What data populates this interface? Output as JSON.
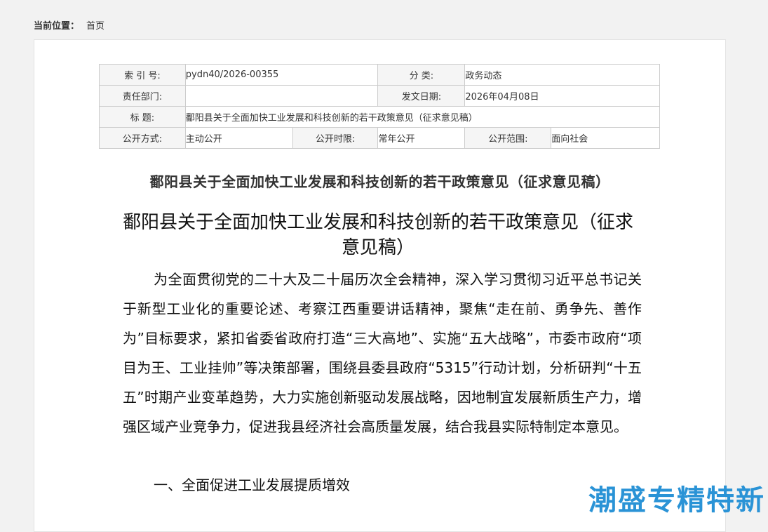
{
  "breadcrumb": {
    "label": "当前位置：",
    "current": "首页"
  },
  "meta": {
    "index_key": "索 引 号:",
    "index_value": "pydn40/2026-00355",
    "category_key": "分 类:",
    "category_value": "政务动态",
    "dept_key": "责任部门:",
    "dept_value": "",
    "date_key": "发文日期:",
    "date_value": "2026年04月08日",
    "title_key": "标 题:",
    "title_value": "鄱阳县关于全面加快工业发展和科技创新的若干政策意见（征求意见稿）",
    "method_key": "公开方式:",
    "method_value": "主动公开",
    "period_key": "公开时限:",
    "period_value": "常年公开",
    "scope_key": "公开范围:",
    "scope_value": "面向社会"
  },
  "article": {
    "title": "鄱阳县关于全面加快工业发展和科技创新的若干政策意见（征求意见稿）",
    "heading": "鄱阳县关于全面加快工业发展和科技创新的若干政策意见（征求意见稿）",
    "paragraph": "为全面贯彻党的二十大及二十届历次全会精神，深入学习贯彻习近平总书记关于新型工业化的重要论述、考察江西重要讲话精神，聚焦“走在前、勇争先、善作为”目标要求，紧扣省委省政府打造“三大高地”、实施“五大战略”，市委市政府“项目为王、工业挂帅”等决策部署，围绕县委县政府“5315”行动计划，分析研判“十五五”时期产业变革趋势，大力实施创新驱动发展战略，因地制宜发展新质生产力，增强区域产业竞争力，促进我县经济社会高质量发展，结合我县实际特制定本意见。",
    "section_1": "一、全面促进工业发展提质增效"
  },
  "watermark": {
    "text": "潮盛专精特新"
  },
  "colors": {
    "watermark": "#2a93d6",
    "table_border": "#cccccc",
    "key_cell_bg": "#f5f5f5"
  }
}
